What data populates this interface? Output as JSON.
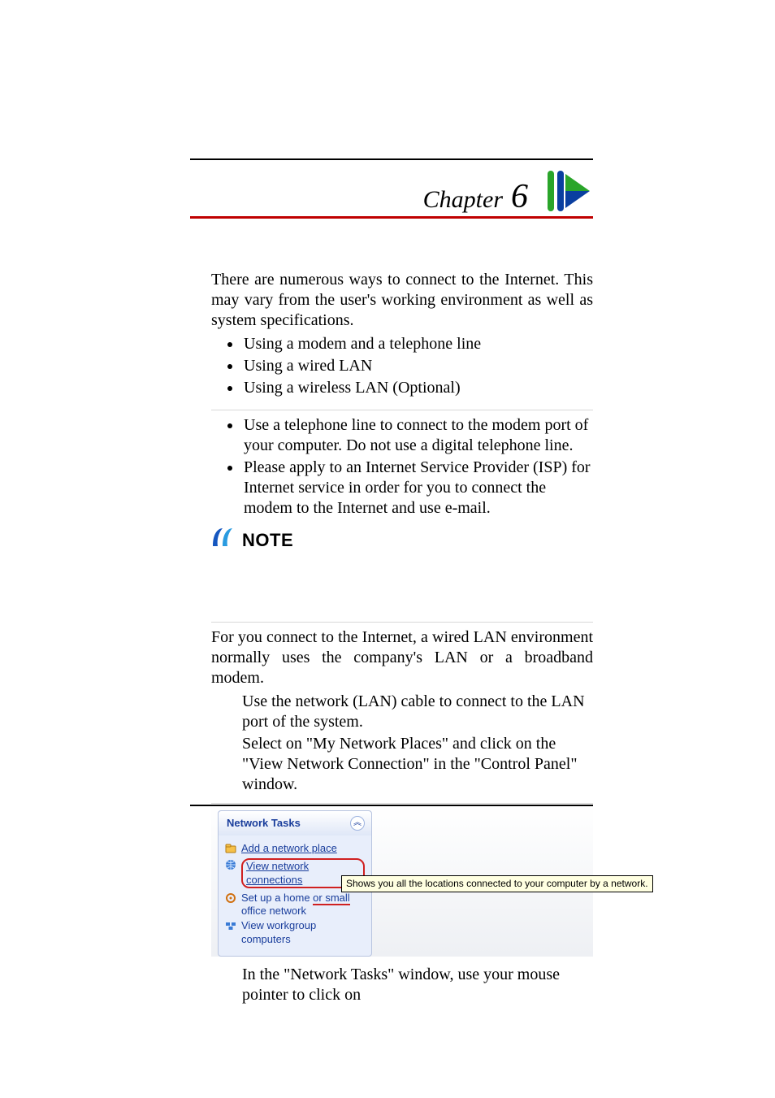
{
  "chapter": {
    "word": "Chapter",
    "number": "6"
  },
  "intro": {
    "p1": "There are numerous ways to connect to the Internet. This may vary from the user's working environment as well as system specifications.",
    "bullets": [
      "Using a modem and a telephone line",
      "Using a wired LAN",
      "Using a wireless LAN (Optional)"
    ]
  },
  "notes": {
    "bullets": [
      "Use a telephone line to connect to the modem port of your computer. Do not use a digital telephone line.",
      "Please apply to an Internet Service Provider (ISP) for Internet service in order for you to connect the modem to the Internet and use e-mail."
    ],
    "note_label": "NOTE"
  },
  "wired": {
    "p1": "For you connect to the Internet, a wired LAN environment normally uses the company's LAN or a broadband modem.",
    "steps": [
      "Use the network (LAN) cable to connect to the LAN port of the system.",
      "Select on \"My Network Places\" and click on the \"View Network Connection\" in the \"Control Panel\" window."
    ],
    "after_panel": "In the \"Network Tasks\" window, use your mouse pointer to click on"
  },
  "network_tasks": {
    "title": "Network Tasks",
    "items": {
      "add": "Add a network place",
      "view_conn": "View network connections",
      "setup_l1_a": "Set up a home ",
      "setup_l1_b": "or small",
      "setup_l2": "office network",
      "workgroup": "View workgroup computers"
    },
    "tooltip": "Shows you all the locations connected to your computer by a network.",
    "collapse_glyph": "︽"
  },
  "icons": {
    "chapter_arrow": "chapter-arrow-icon",
    "note": "note-icon",
    "collapse": "collapse-icon",
    "add_place": "folder-plus-icon",
    "globe": "globe-icon",
    "home_net": "home-network-icon",
    "workgroup": "workgroup-icon"
  }
}
